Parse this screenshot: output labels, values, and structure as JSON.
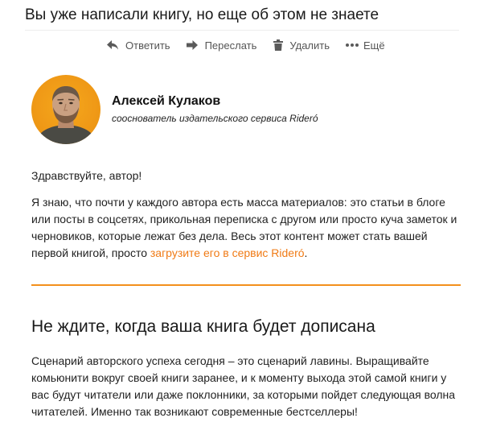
{
  "email": {
    "subject": "Вы уже написали книгу, но еще об этом не знаете"
  },
  "toolbar": {
    "reply_label": "Ответить",
    "forward_label": "Переслать",
    "delete_label": "Удалить",
    "more_label": "Ещё",
    "icons": [
      "reply-icon",
      "forward-icon",
      "trash-icon",
      "more-dots-icon"
    ],
    "icon_color": "#555555"
  },
  "sender": {
    "name": "Алексей Кулаков",
    "role": "сооснователь издательского сервиса Rideró",
    "avatar_background": "#f4a81c"
  },
  "content": {
    "greeting": "Здравствуйте, автор!",
    "paragraph1_text": "Я знаю, что почти у каждого автора есть масса материалов: это статьи в блоге или посты в соцсетях, прикольная переписка с другом или просто куча заметок и черновиков, которые лежат без дела. Весь этот контент может стать вашей первой книгой, просто ",
    "paragraph1_link": "загрузите его в сервис Rideró",
    "paragraph1_end": ".",
    "section_heading": "Не ждите, когда ваша книга будет дописана",
    "paragraph2": "Сценарий авторского успеха сегодня – это сценарий лавины. Выращивайте комьюнити вокруг своей книги заранее, и к моменту выхода этой самой книги у вас будут читатели или даже поклонники, за которыми пойдет следующая волна читателей. Именно так возникают современные бестселлеры!"
  },
  "colors": {
    "accent": "#f07b16",
    "rule": "#f3901c",
    "text": "#222222"
  }
}
